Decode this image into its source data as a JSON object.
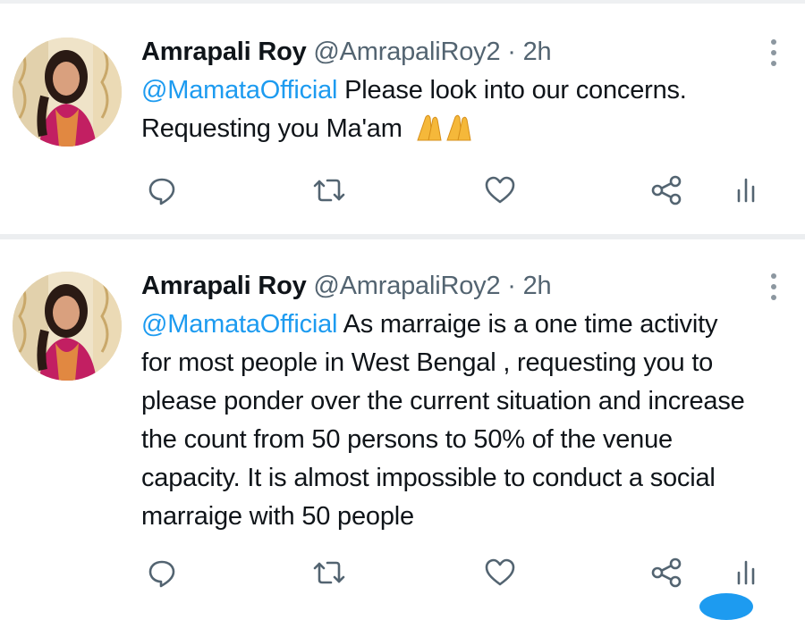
{
  "tweets": [
    {
      "display_name": "Amrapali Roy",
      "handle": "@AmrapaliRoy2",
      "separator": "·",
      "time": "2h",
      "mention": "@MamataOfficial",
      "text_lines": [
        " Please look into our concerns.",
        "Requesting you Ma'am"
      ],
      "emoji": "folded-hands"
    },
    {
      "display_name": "Amrapali Roy",
      "handle": "@AmrapaliRoy2",
      "separator": "·",
      "time": "2h",
      "mention": "@MamataOfficial",
      "text_lines": [
        " As marraige is a one time activity",
        "for most people in West Bengal , requesting you to",
        "please ponder over the current situation and increase",
        "the count from 50 persons to 50% of the venue",
        "capacity. It is almost impossible to conduct a social",
        "marraige with 50 people"
      ]
    }
  ],
  "icons": {
    "reply": "reply-icon",
    "retweet": "retweet-icon",
    "like": "like-icon",
    "share": "share-icon",
    "analytics": "analytics-icon",
    "more": "more-options-icon"
  },
  "colors": {
    "accent": "#1d9bf0",
    "text": "#0f1419",
    "muted": "#536471",
    "divider": "#eceef0"
  }
}
